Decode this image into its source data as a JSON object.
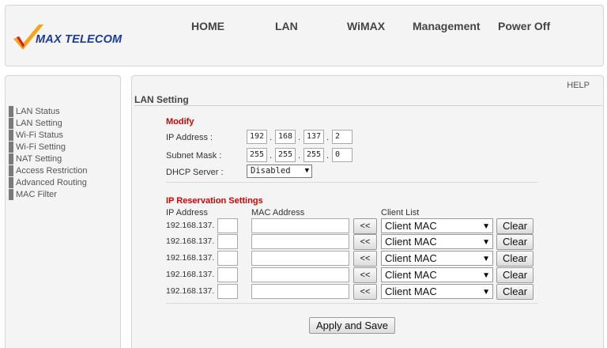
{
  "header": {
    "logo_text": "MAX TELECOM",
    "nav": [
      "HOME",
      "LAN",
      "WiMAX",
      "Management",
      "Power Off"
    ]
  },
  "sidebar": {
    "items": [
      "LAN Status",
      "LAN Setting",
      "Wi-Fi Status",
      "Wi-Fi Setting",
      "NAT Setting",
      "Access Restriction",
      "Advanced Routing",
      "MAC Filter"
    ]
  },
  "main": {
    "help": "HELP",
    "title": "LAN Setting",
    "modify": {
      "heading": "Modify",
      "ip_label": "IP Address :",
      "ip": [
        "192",
        "168",
        "137",
        "2"
      ],
      "mask_label": "Subnet Mask :",
      "mask": [
        "255",
        "255",
        "255",
        "0"
      ],
      "dhcp_label": "DHCP Server :",
      "dhcp_value": "Disabled"
    },
    "reservation": {
      "heading": "IP Reservation Settings",
      "col_ip": "IP Address",
      "col_mac": "MAC Address",
      "col_client": "Client List",
      "rows": [
        {
          "prefix": "192.168.137.",
          "copy": "<<",
          "client": "Client MAC",
          "clear": "Clear"
        },
        {
          "prefix": "192.168.137.",
          "copy": "<<",
          "client": "Client MAC",
          "clear": "Clear"
        },
        {
          "prefix": "192.168.137.",
          "copy": "<<",
          "client": "Client MAC",
          "clear": "Clear"
        },
        {
          "prefix": "192.168.137.",
          "copy": "<<",
          "client": "Client MAC",
          "clear": "Clear"
        },
        {
          "prefix": "192.168.137.",
          "copy": "<<",
          "client": "Client MAC",
          "clear": "Clear"
        }
      ]
    },
    "apply_label": "Apply and Save"
  }
}
